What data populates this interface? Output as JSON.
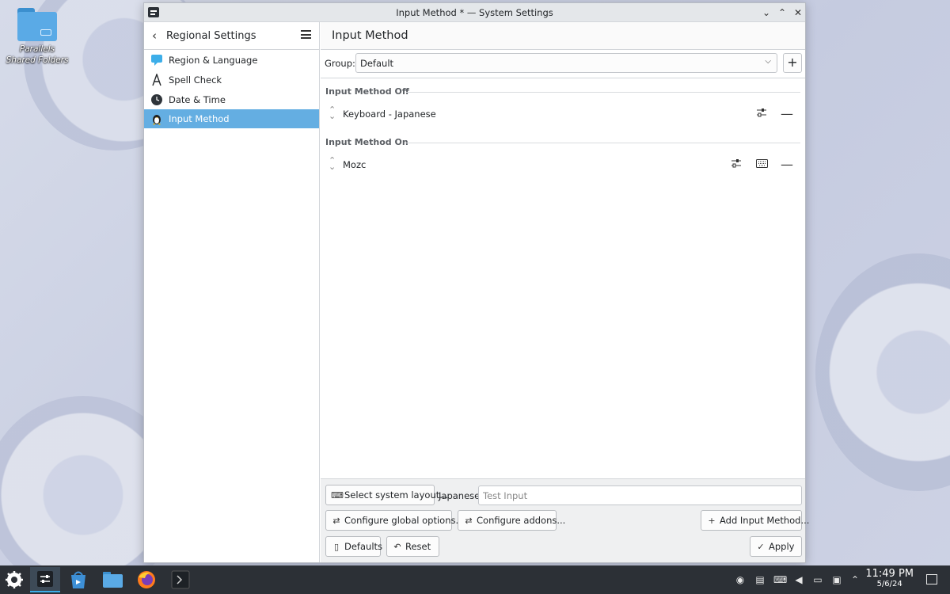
{
  "desktop": {
    "folder_label": "Parallels Shared Folders"
  },
  "window": {
    "title": "Input Method * — System Settings",
    "minimize": "⌄",
    "maximize": "⌃",
    "close": "✕"
  },
  "sidebar": {
    "title": "Regional Settings",
    "items": [
      {
        "label": "Region & Language",
        "icon": "chat-bubble-icon"
      },
      {
        "label": "Spell Check",
        "icon": "letter-a-icon"
      },
      {
        "label": "Date & Time",
        "icon": "clock-icon"
      },
      {
        "label": "Input Method",
        "icon": "tux-icon",
        "active": true
      }
    ]
  },
  "content": {
    "title": "Input Method",
    "group_label": "Group:",
    "group_value": "Default",
    "sections": [
      {
        "heading": "Input Method Off",
        "items": [
          {
            "name": "Keyboard - Japanese"
          }
        ]
      },
      {
        "heading": "Input Method On",
        "items": [
          {
            "name": "Mozc"
          }
        ]
      }
    ]
  },
  "bottom": {
    "select_layout": "Select system layout...",
    "language": "Japanese",
    "test_placeholder": "Test Input",
    "global_options": "Configure global options...",
    "addons": "Configure addons...",
    "add_input_method": "Add Input Method...",
    "defaults": "Defaults",
    "reset": "Reset",
    "apply": "Apply"
  },
  "taskbar": {
    "time": "11:49 PM",
    "date": "5/6/24"
  },
  "colors": {
    "accent": "#64aee2",
    "taskbar": "#2c3036"
  }
}
